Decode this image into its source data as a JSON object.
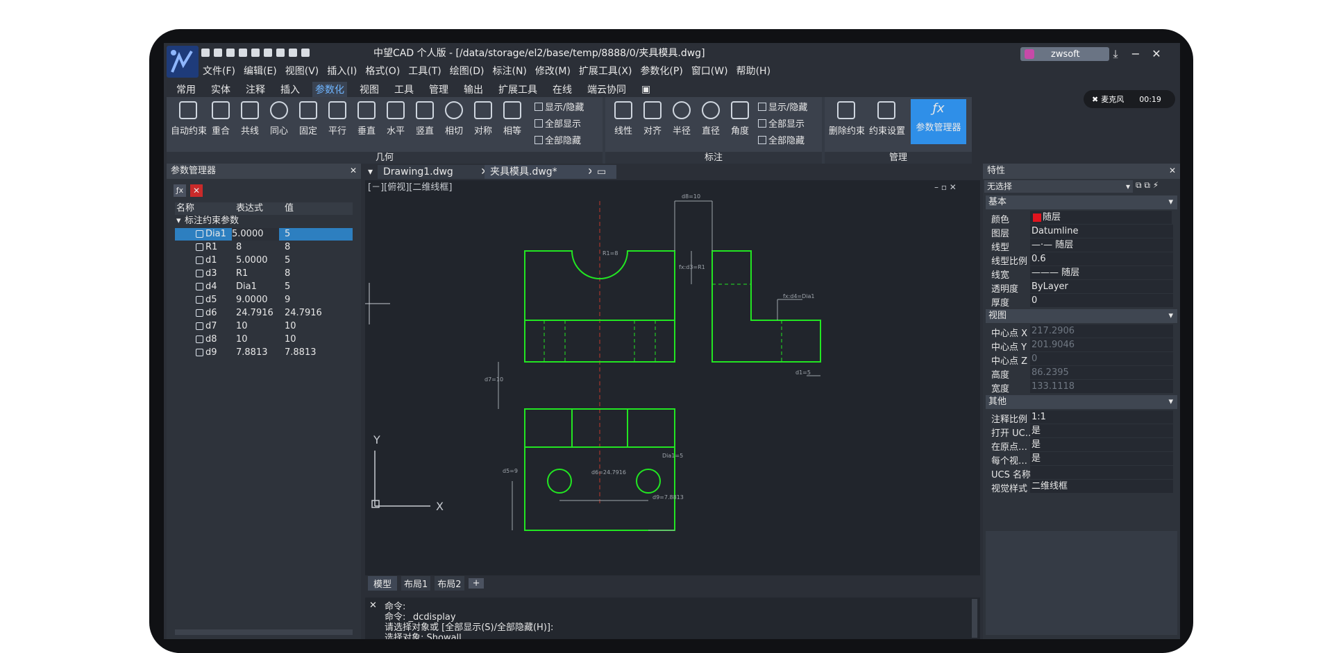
{
  "app": {
    "title": "中望CAD 个人版 - [/data/storage/el2/base/temp/8888/0/夹具模具.dwg]",
    "user": "zwsoft",
    "window_controls": [
      "⤓",
      "−",
      "✕"
    ]
  },
  "menu": [
    "文件(F)",
    "编辑(E)",
    "视图(V)",
    "插入(I)",
    "格式(O)",
    "工具(T)",
    "绘图(D)",
    "标注(N)",
    "修改(M)",
    "扩展工具(X)",
    "参数化(P)",
    "窗口(W)",
    "帮助(H)"
  ],
  "ribbon_tabs": [
    "常用",
    "实体",
    "注释",
    "插入",
    "参数化",
    "视图",
    "工具",
    "管理",
    "输出",
    "扩展工具",
    "在线",
    "端云协同"
  ],
  "ribbon_active_tab": "参数化",
  "ribbon": {
    "geometry_group": "几何",
    "geometry_buttons": [
      "自动约束",
      "重合",
      "共线",
      "同心",
      "固定",
      "平行",
      "垂直",
      "水平",
      "竖直",
      "相切",
      "对称",
      "相等"
    ],
    "geometry_opts": [
      "显示/隐藏",
      "全部显示",
      "全部隐藏"
    ],
    "dim_group": "标注",
    "dim_buttons": [
      "线性",
      "对齐",
      "半径",
      "直径",
      "角度"
    ],
    "dim_opts": [
      "显示/隐藏",
      "全部显示",
      "全部隐藏"
    ],
    "manage_group": "管理",
    "manage_buttons": [
      "删除约束",
      "约束设置",
      "参数管理器"
    ]
  },
  "recorder": {
    "mic": "麦克风",
    "time": "00:19"
  },
  "param_panel": {
    "title": "参数管理器",
    "headers": [
      "名称",
      "表达式",
      "值"
    ],
    "group": "标注约束参数",
    "rows": [
      {
        "name": "Dia1",
        "expr": "5.0000",
        "value": "5"
      },
      {
        "name": "R1",
        "expr": "8",
        "value": "8"
      },
      {
        "name": "d1",
        "expr": "5.0000",
        "value": "5"
      },
      {
        "name": "d3",
        "expr": "R1",
        "value": "8"
      },
      {
        "name": "d4",
        "expr": "Dia1",
        "value": "5"
      },
      {
        "name": "d5",
        "expr": "9.0000",
        "value": "9"
      },
      {
        "name": "d6",
        "expr": "24.7916",
        "value": "24.7916"
      },
      {
        "name": "d7",
        "expr": "10",
        "value": "10"
      },
      {
        "name": "d8",
        "expr": "10",
        "value": "10"
      },
      {
        "name": "d9",
        "expr": "7.8813",
        "value": "7.8813"
      }
    ]
  },
  "doc_tabs": [
    {
      "label": "Drawing1.dwg"
    },
    {
      "label": "夹具模具.dwg*"
    }
  ],
  "viewport_label": "[－][俯视][二维线框]",
  "drawing_labels": {
    "d8": "d8=10",
    "r1": "R1=8",
    "d3": "fx:d3=R1",
    "d4": "fx:d4=Dia1",
    "d7": "d7=10",
    "d1": "d1=5",
    "d5": "d5=9",
    "d6": "d6=24.7916",
    "d9": "d9=7.8813",
    "dia1": "Dia1=5",
    "ucs_x": "X",
    "ucs_y": "Y"
  },
  "layout_tabs": [
    "模型",
    "布局1",
    "布局2"
  ],
  "command": {
    "lines": [
      "命令:",
      "命令: _dcdisplay",
      "请选择对象或 [全部显示(S)/全部隐藏(H)]:",
      "选择对象:  Showall"
    ]
  },
  "properties": {
    "title": "特性",
    "selection": "无选择",
    "sections": {
      "basic": "基本",
      "view": "视图",
      "other": "其他"
    },
    "basic": [
      {
        "k": "颜色",
        "v": "随层",
        "dd": true
      },
      {
        "k": "图层",
        "v": "Datumline",
        "dd": true
      },
      {
        "k": "线型",
        "v": "—·— 随层",
        "dd": true
      },
      {
        "k": "线型比例",
        "v": "0.6",
        "dd": false
      },
      {
        "k": "线宽",
        "v": "——— 随层",
        "dd": true
      },
      {
        "k": "透明度",
        "v": "ByLayer",
        "dd": false
      },
      {
        "k": "厚度",
        "v": "0",
        "dd": false
      }
    ],
    "view": [
      {
        "k": "中心点 X",
        "v": "217.2906"
      },
      {
        "k": "中心点 Y",
        "v": "201.9046"
      },
      {
        "k": "中心点 Z",
        "v": "0"
      },
      {
        "k": "高度",
        "v": "86.2395"
      },
      {
        "k": "宽度",
        "v": "133.1118"
      }
    ],
    "other": [
      {
        "k": "注释比例",
        "v": "1:1",
        "dd": true
      },
      {
        "k": "打开 UC…",
        "v": "是",
        "dd": true
      },
      {
        "k": "在原点…",
        "v": "是",
        "dd": true
      },
      {
        "k": "每个视…",
        "v": "是",
        "dd": true
      },
      {
        "k": "UCS 名称",
        "v": "",
        "dd": false
      },
      {
        "k": "视觉样式",
        "v": "二维线框",
        "dd": true
      }
    ]
  },
  "colors": {
    "accent": "#2f8fe8",
    "geometry": "#22e622",
    "centerline": "#c0392b",
    "layer_red": "#e0141e"
  }
}
